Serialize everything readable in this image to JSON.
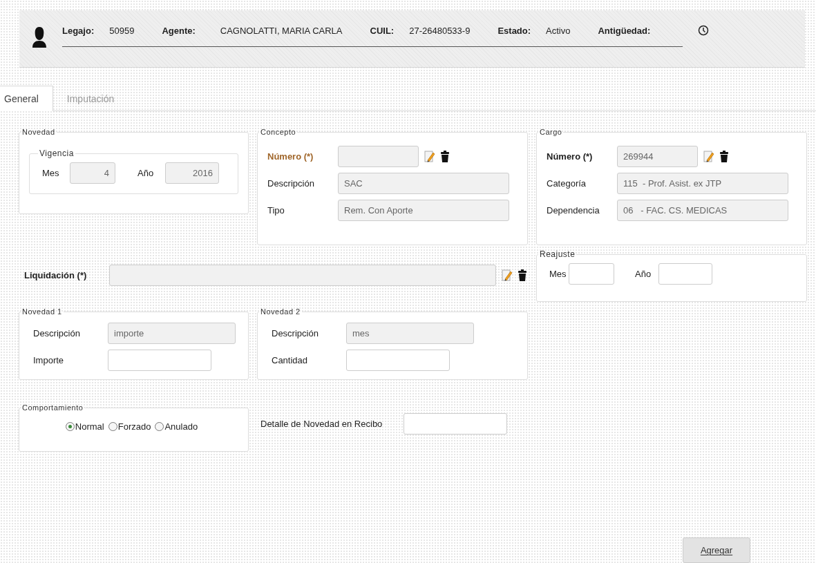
{
  "header": {
    "fields": [
      {
        "label": "Legajo:",
        "value": "50959"
      },
      {
        "label": "Agente:",
        "value": "CAGNOLATTI, MARIA CARLA"
      },
      {
        "label": "CUIL:",
        "value": "27-26480533-9"
      },
      {
        "label": "Estado:",
        "value": "Activo"
      },
      {
        "label": "Antigüedad:"
      }
    ]
  },
  "tabs": [
    {
      "label": "General",
      "selected": true
    },
    {
      "label": "Imputación",
      "selected": false
    }
  ],
  "novedad": {
    "title": "Novedad",
    "vigencia": {
      "title": "Vigencia",
      "fields": [
        {
          "label": "Mes",
          "value": "4",
          "disabled": true
        },
        {
          "label": "Año",
          "value": "2016",
          "disabled": true
        }
      ]
    }
  },
  "concepto": {
    "title": "Concepto",
    "rows": [
      {
        "label": "Número (*)",
        "kind": "lookup",
        "highlighted": true,
        "disabled": true
      },
      {
        "label": "Descripción",
        "value": "SAC",
        "kind": "text",
        "disabled": true
      },
      {
        "label": "Tipo",
        "value": "Rem. Con Aporte",
        "kind": "text",
        "disabled": true
      }
    ]
  },
  "cargo": {
    "title": "Cargo",
    "rows": [
      {
        "label": "Número (*)",
        "value": "269944",
        "kind": "lookup",
        "highlighted": false,
        "disabled": true
      },
      {
        "label": "Categoría",
        "value": "115  - Prof. Asist. ex JTP",
        "kind": "text",
        "disabled": true
      },
      {
        "label": "Dependencia",
        "value": "06   - FAC. CS. MEDICAS",
        "kind": "text",
        "disabled": true
      }
    ]
  },
  "liquidacion": {
    "label": "Liquidación (*)",
    "disabled": true
  },
  "reajuste": {
    "title": "Reajuste",
    "fields": [
      {
        "label": "Mes",
        "disabled": false
      },
      {
        "label": "Año",
        "disabled": false
      }
    ]
  },
  "novedad_1": {
    "title": "Novedad 1",
    "rows": [
      {
        "label": "Descripción",
        "value": "importe",
        "disabled": true
      },
      {
        "label": "Importe",
        "disabled": false
      }
    ]
  },
  "novedad_2": {
    "title": "Novedad 2",
    "rows": [
      {
        "label": "Descripción",
        "value": "mes",
        "disabled": true
      },
      {
        "label": "Cantidad",
        "disabled": false
      }
    ]
  },
  "comportamiento": {
    "title": "Comportamiento",
    "options": [
      {
        "label": "Normal",
        "selected": true
      },
      {
        "label": "Forzado",
        "selected": false
      },
      {
        "label": "Anulado",
        "selected": false
      }
    ]
  },
  "detalle": {
    "label": "Detalle de Novedad en Recibo"
  },
  "button": {
    "label": "Agregar"
  }
}
